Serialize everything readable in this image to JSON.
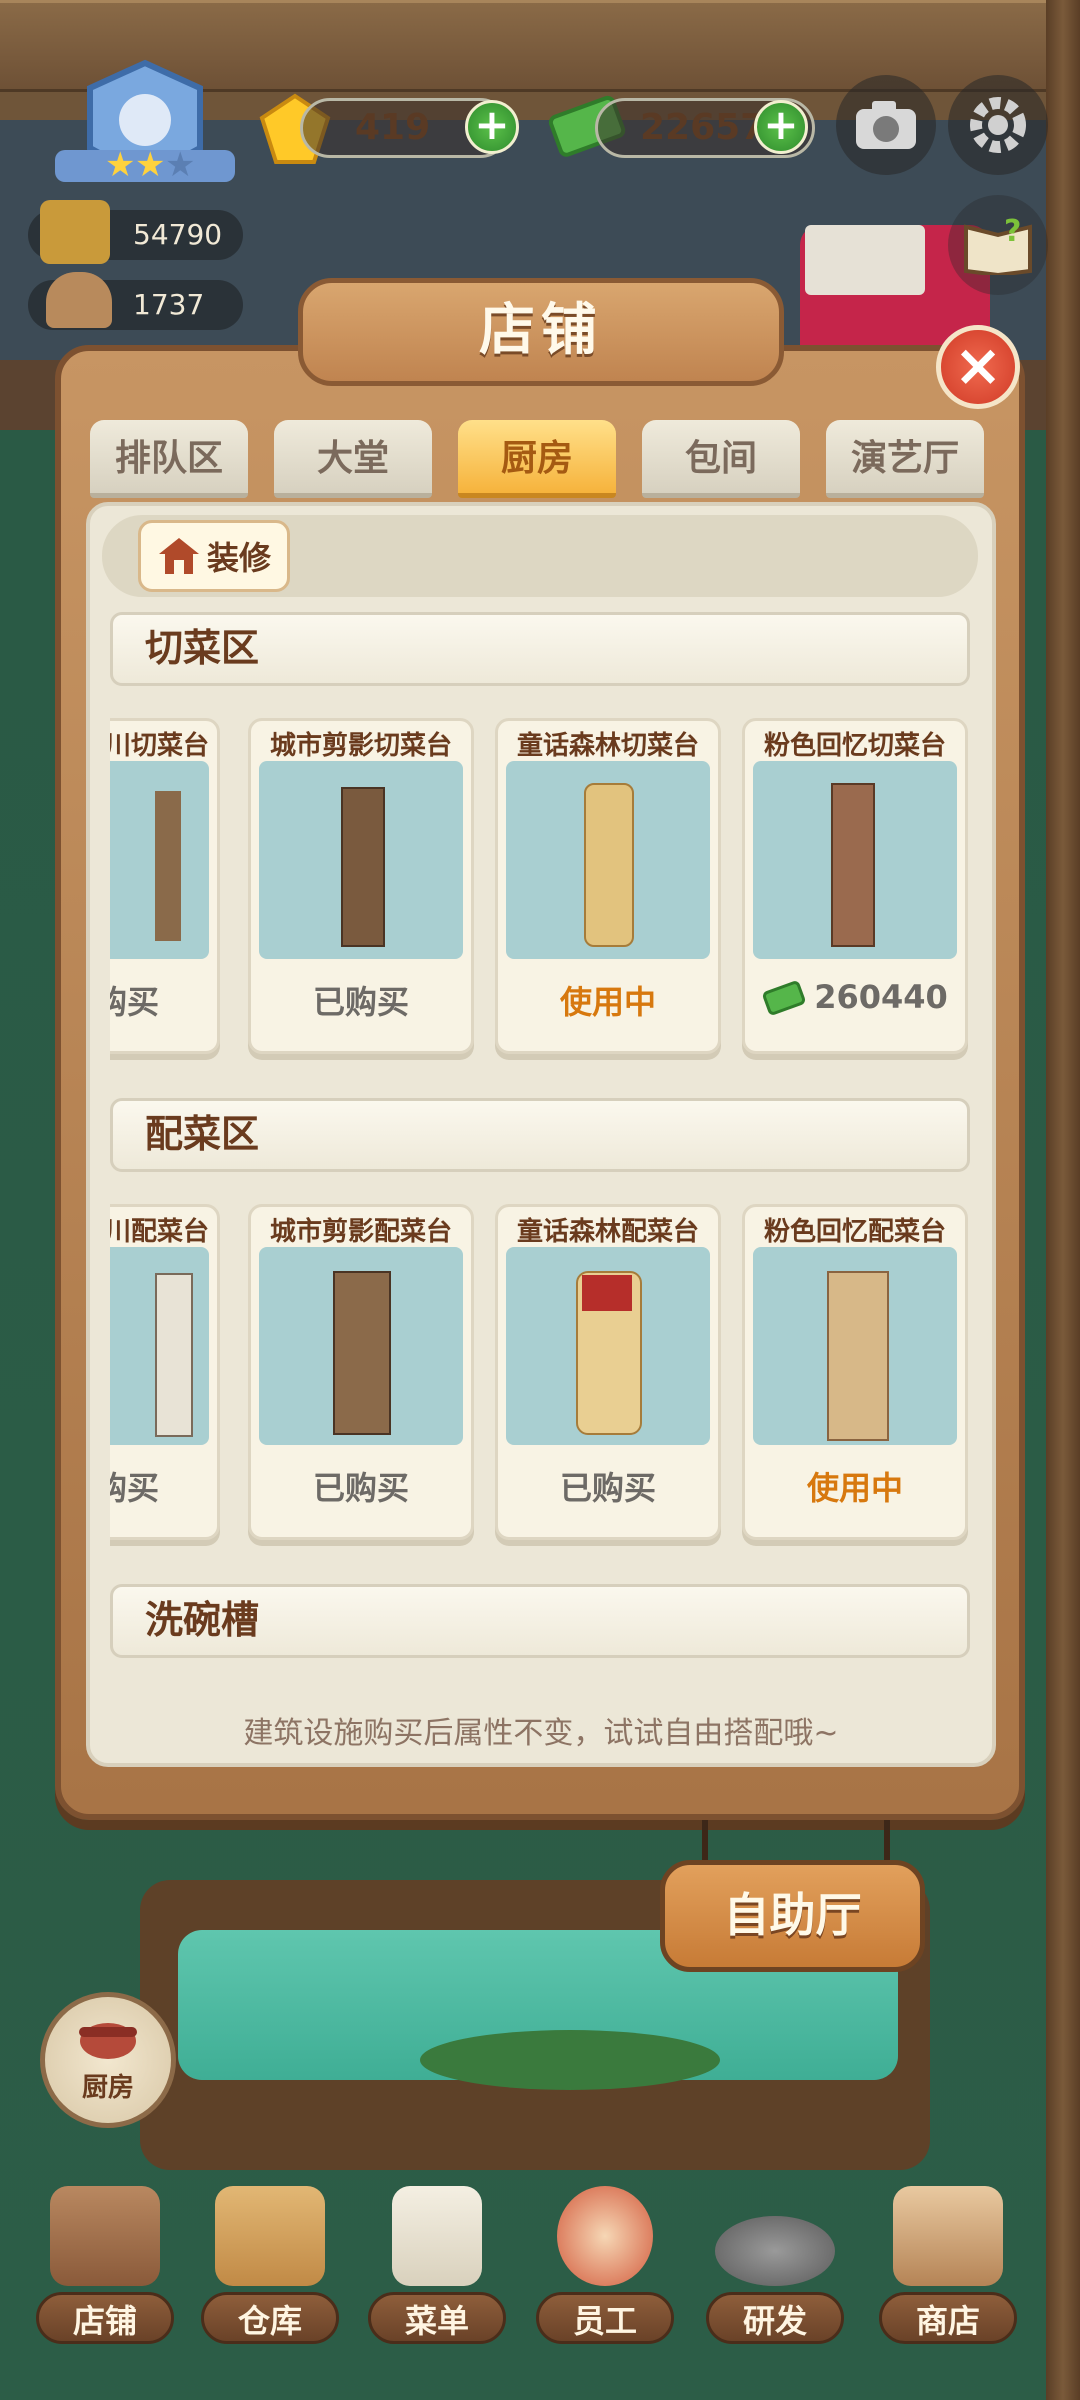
{
  "hud": {
    "gems": "419",
    "cash": "226576",
    "plus_label": "+",
    "stat_1": "54790",
    "stat_2": "1737"
  },
  "dialog": {
    "title": "店铺",
    "close_label": "×",
    "tabs": [
      {
        "label": "排队区",
        "active": false
      },
      {
        "label": "大堂",
        "active": false
      },
      {
        "label": "厨房",
        "active": true
      },
      {
        "label": "包间",
        "active": false
      },
      {
        "label": "演艺厅",
        "active": false
      }
    ],
    "renovate_label": "装修",
    "sections": [
      {
        "title": "切菜区",
        "items": [
          {
            "name": "川切菜台",
            "status": "购买"
          },
          {
            "name": "城市剪影切菜台",
            "status": "已购买"
          },
          {
            "name": "童话森林切菜台",
            "status": "使用中"
          },
          {
            "name": "粉色回忆切菜台",
            "price": "260440"
          }
        ]
      },
      {
        "title": "配菜区",
        "items": [
          {
            "name": "川配菜台",
            "status": "购买"
          },
          {
            "name": "城市剪影配菜台",
            "status": "已购买"
          },
          {
            "name": "童话森林配菜台",
            "status": "已购买"
          },
          {
            "name": "粉色回忆配菜台",
            "status": "使用中"
          }
        ]
      },
      {
        "title": "洗碗槽"
      }
    ],
    "hint": "建筑设施购买后属性不变，试试自由搭配哦~"
  },
  "buffet_label": "自助厅",
  "kitchen_label": "厨房",
  "nav": [
    {
      "label": "店铺",
      "icon": "shop-house-icon"
    },
    {
      "label": "仓库",
      "icon": "warehouse-boxes-icon"
    },
    {
      "label": "菜单",
      "icon": "menu-clipboard-icon"
    },
    {
      "label": "员工",
      "icon": "staff-chef-icon"
    },
    {
      "label": "研发",
      "icon": "research-wok-icon"
    },
    {
      "label": "商店",
      "icon": "store-front-icon"
    }
  ],
  "colors": {
    "active_tab": "#f6b33c",
    "in_use": "#d7780e",
    "wood": "#a87446"
  }
}
